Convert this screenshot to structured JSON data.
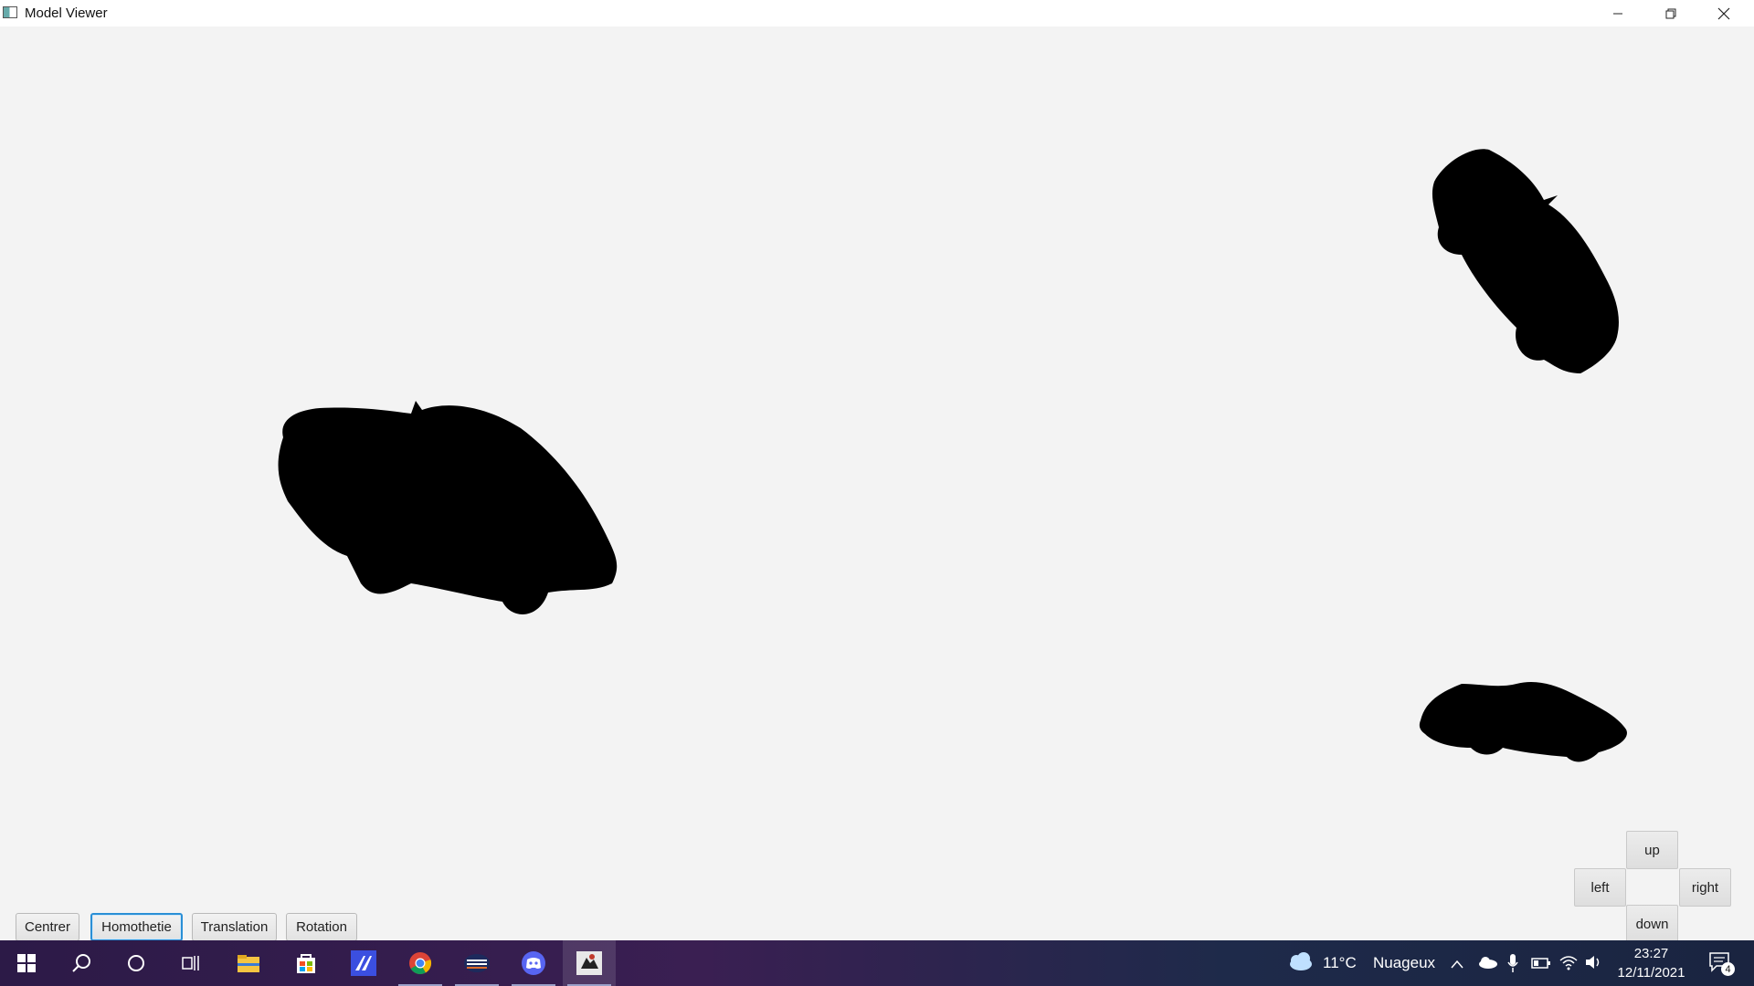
{
  "window": {
    "title": "Model Viewer",
    "controls": {
      "minimize": "minimize-icon",
      "maximize": "restore-icon",
      "close": "close-icon"
    }
  },
  "toolbar": {
    "buttons": [
      {
        "label": "Centrer",
        "active": false
      },
      {
        "label": "Homothetie",
        "active": true
      },
      {
        "label": "Translation",
        "active": false
      },
      {
        "label": "Rotation",
        "active": false
      }
    ]
  },
  "dpad": {
    "up": "up",
    "left": "left",
    "right": "right",
    "down": "down"
  },
  "scene": {
    "models": [
      {
        "name": "car-large",
        "color": "#000000"
      },
      {
        "name": "car-rotated",
        "color": "#000000"
      },
      {
        "name": "car-small",
        "color": "#000000"
      }
    ]
  },
  "taskbar": {
    "apps": [
      {
        "icon": "windows-start-icon"
      },
      {
        "icon": "search-icon"
      },
      {
        "icon": "cortana-icon"
      },
      {
        "icon": "task-view-icon"
      },
      {
        "icon": "file-explorer-icon"
      },
      {
        "icon": "store-icon"
      },
      {
        "icon": "editor-icon"
      },
      {
        "icon": "chrome-icon"
      },
      {
        "icon": "terminal-icon"
      },
      {
        "icon": "discord-icon"
      },
      {
        "icon": "java-app-icon"
      }
    ],
    "weather": {
      "temp": "11°C",
      "condition": "Nuageux"
    },
    "clock": {
      "time": "23:27",
      "date": "12/11/2021"
    },
    "notifications": {
      "count": "4"
    },
    "colors": {
      "accent": "#2a8fd6",
      "taskbar": "#2c1a47"
    }
  }
}
